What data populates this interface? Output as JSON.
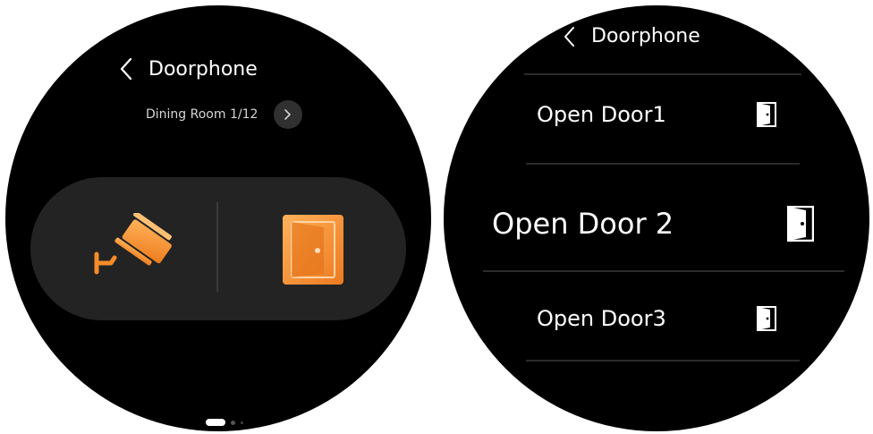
{
  "screen1": {
    "header": {
      "title": "Doorphone"
    },
    "room": {
      "label": "Dining Room 1/12"
    },
    "actions": [
      {
        "name": "camera",
        "icon": "security-camera-icon"
      },
      {
        "name": "door",
        "icon": "door-open-icon"
      }
    ],
    "page_indicator": {
      "current": 1,
      "total": 3
    },
    "colors": {
      "accent": "#F7922E",
      "pill": "#232323",
      "background": "#000000"
    }
  },
  "screen2": {
    "header": {
      "title": "Doorphone"
    },
    "doors": [
      {
        "label": "Open Door1",
        "icon": "door-icon"
      },
      {
        "label": "Open Door 2",
        "icon": "door-icon"
      },
      {
        "label": "Open Door3",
        "icon": "door-icon"
      }
    ]
  }
}
